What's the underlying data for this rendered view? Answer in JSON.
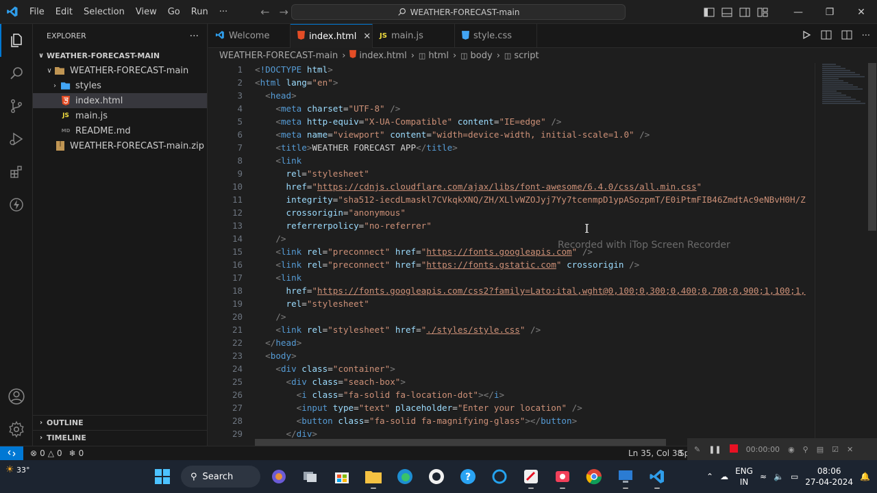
{
  "titlebar": {
    "menu": [
      "File",
      "Edit",
      "Selection",
      "View",
      "Go",
      "Run",
      "···"
    ],
    "command_center": "WEATHER-FORECAST-main"
  },
  "explorer": {
    "title": "EXPLORER",
    "root": "WEATHER-FORECAST-MAIN",
    "items": [
      {
        "label": "WEATHER-FORECAST-main",
        "type": "folder-open"
      },
      {
        "label": "styles",
        "type": "folder"
      },
      {
        "label": "index.html",
        "type": "html"
      },
      {
        "label": "main.js",
        "type": "js"
      },
      {
        "label": "README.md",
        "type": "md"
      },
      {
        "label": "WEATHER-FORECAST-main.zip",
        "type": "zip"
      }
    ],
    "outline": "OUTLINE",
    "timeline": "TIMELINE"
  },
  "tabs": [
    {
      "label": "Welcome",
      "icon": "vscode"
    },
    {
      "label": "index.html",
      "icon": "html"
    },
    {
      "label": "main.js",
      "icon": "js"
    },
    {
      "label": "style.css",
      "icon": "css"
    }
  ],
  "breadcrumb": [
    "WEATHER-FORECAST-main",
    "index.html",
    "html",
    "body",
    "script"
  ],
  "editor": {
    "line_numbers": [
      "1",
      "2",
      "3",
      "4",
      "5",
      "6",
      "7",
      "8",
      "9",
      "10",
      "11",
      "12",
      "13",
      "14",
      "15",
      "16",
      "17",
      "18",
      "19",
      "20",
      "21",
      "22",
      "23",
      "24",
      "25",
      "26",
      "27",
      "28",
      "29"
    ],
    "watermark": "Recorded with iTop Screen Recorder"
  },
  "statusbar": {
    "problems": "0",
    "warnings": "0",
    "ports": "0",
    "position": "Ln 35, Col 38",
    "spaces": "Sp"
  },
  "recorder": {
    "time": "00:00:00"
  },
  "taskbar": {
    "weather": "33°",
    "search": "Search",
    "lang_top": "ENG",
    "lang_bottom": "IN",
    "time": "08:06",
    "date": "27-04-2024"
  },
  "colors": {
    "accent": "#0078d4",
    "tag": "#569cd6",
    "attr": "#9cdcfe",
    "string": "#ce9178",
    "html_icon": "#e44d26",
    "js_icon": "#f1dd3f",
    "css_icon": "#42a5f5"
  }
}
